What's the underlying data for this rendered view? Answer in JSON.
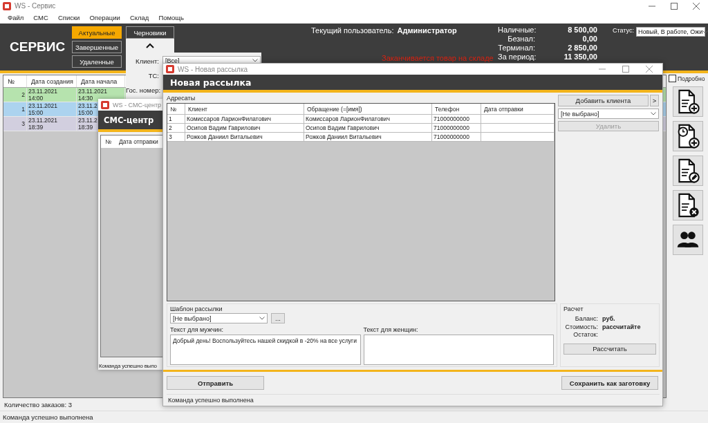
{
  "main_window": {
    "title": "WS - Сервис",
    "menu": [
      "Файл",
      "СМС",
      "Списки",
      "Операции",
      "Склад",
      "Помощь"
    ],
    "logo": "СЕРВИС",
    "filter_tabs": [
      {
        "label": "Актуальные",
        "selected": true
      },
      {
        "label": "Завершенные",
        "selected": false
      },
      {
        "label": "Удаленные",
        "selected": false
      },
      {
        "label": "Черновики",
        "selected": false
      }
    ],
    "current_user_label": "Текущий пользователь:",
    "current_user": "Администратор",
    "warning": "Заканчивается товар на складе",
    "totals": [
      {
        "label": "Наличные:",
        "value": "8 500,00"
      },
      {
        "label": "Безнал:",
        "value": "0,00"
      },
      {
        "label": "Терминал:",
        "value": "2 850,00"
      },
      {
        "label": "За период:",
        "value": "11 350,00"
      }
    ],
    "status_filter": {
      "label": "Статус:",
      "value": "Новый, В работе, Ожи"
    },
    "orders_table": {
      "columns": [
        "№",
        "Дата создания",
        "Дата начала"
      ],
      "rows": [
        {
          "cells": [
            "2",
            "23.11.2021\n14:00",
            "23.11.2021\n14:30"
          ],
          "color": "#b6e3ae"
        },
        {
          "cells": [
            "1",
            "23.11.2021\n15:00",
            "23.11.2\n15:00"
          ],
          "color": "#acd3ef"
        },
        {
          "cells": [
            "3",
            "23.11.2021\n18:39",
            "23.11.2\n18:39"
          ],
          "color": "#d2cfdf"
        }
      ]
    },
    "details_checkbox": {
      "label": "Подробно",
      "checked": false
    },
    "order_count": "Количество заказов: 3",
    "status_bar": "Команда успешно выполнена"
  },
  "filter_panel": {
    "fields": [
      {
        "label": "Клиент:",
        "value": "[Все]"
      },
      {
        "label": "ТС:"
      },
      {
        "label": "Гос. номер:"
      }
    ]
  },
  "sms_window": {
    "title": "WS - СМС-центр",
    "heading": "СМС-центр",
    "columns": [
      "№",
      "Дата отправки"
    ],
    "status": "Команда успешно выпо"
  },
  "mailing_window": {
    "title": "WS - Новая рассылка",
    "heading": "Новая рассылка",
    "recipients_label": "Адресаты",
    "columns": [
      "№",
      "Клиент",
      "Обращение (=[имя])",
      "Телефон",
      "Дата отправки"
    ],
    "rows": [
      {
        "number": "1",
        "client": "Комиссаров ЛарионФилатович",
        "greeting": "Комиссаров ЛарионФилатович",
        "phone": "71000000000"
      },
      {
        "number": "2",
        "client": "Осипов Вадим Гаврилович",
        "greeting": "Осипов Вадим Гаврилович",
        "phone": "71000000000"
      },
      {
        "number": "3",
        "client": "Рожков Даниил Витальевич",
        "greeting": "Рожков Даниил Витальевич",
        "phone": "71000000000"
      }
    ],
    "add_client_button": "Добавить клиента",
    "more_button": ">",
    "client_select": "[Не выбрано]",
    "delete_button": {
      "label": "Удалить",
      "disabled": true
    },
    "template": {
      "label": "Шаблон рассылки",
      "value": "[Не выбрано]",
      "browse_button": "..."
    },
    "men_text": {
      "label": "Текст для мужчин:",
      "value": "Добрый день! Воспользуйтесь нашей скидкой в -20% на все услуги"
    },
    "women_text": {
      "label": "Текст для женщин:"
    },
    "calculation": {
      "label": "Расчет",
      "rows": [
        {
          "label": "Баланс:",
          "value": "руб."
        },
        {
          "label": "Стоимость:",
          "value": "рассчитайте"
        },
        {
          "label": "Остаток:"
        }
      ],
      "button": "Рассчитать"
    },
    "send_button": "Отправить",
    "save_button": "Сохранить как заготовку",
    "status": "Команда успешно выполнена"
  }
}
